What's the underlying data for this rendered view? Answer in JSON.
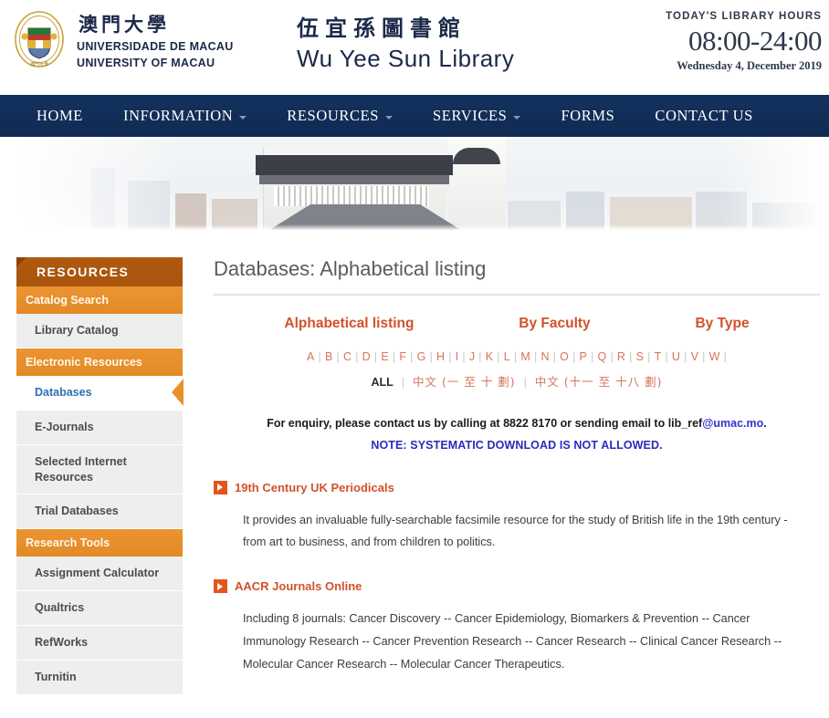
{
  "header": {
    "crest_icon": "university-crest-icon",
    "brand": {
      "cn": "澳門大學",
      "pt": "UNIVERSIDADE DE MACAU",
      "en": "UNIVERSITY OF MACAU"
    },
    "library": {
      "cn": "伍宜孫圖書館",
      "en": "Wu Yee Sun Library"
    },
    "hours": {
      "label": "TODAY'S LIBRARY HOURS",
      "time": "08:00-24:00",
      "date": "Wednesday 4, December 2019"
    }
  },
  "nav": {
    "items": [
      {
        "label": "HOME",
        "caret": false
      },
      {
        "label": "INFORMATION",
        "caret": true
      },
      {
        "label": "RESOURCES",
        "caret": true
      },
      {
        "label": "SERVICES",
        "caret": true
      },
      {
        "label": "FORMS",
        "caret": false
      },
      {
        "label": "CONTACT US",
        "caret": false
      }
    ]
  },
  "banner": {
    "alt": "wu-yee-sun-library-building-photo"
  },
  "sidebar": {
    "heading": "RESOURCES",
    "blocks": [
      {
        "type": "group",
        "label": "Catalog Search"
      },
      {
        "type": "link",
        "label": "Library Catalog",
        "active": false
      },
      {
        "type": "group",
        "label": "Electronic Resources"
      },
      {
        "type": "link",
        "label": "Databases",
        "active": true
      },
      {
        "type": "link",
        "label": "E-Journals",
        "active": false
      },
      {
        "type": "link",
        "label": "Selected Internet Resources",
        "active": false
      },
      {
        "type": "link",
        "label": "Trial Databases",
        "active": false
      },
      {
        "type": "group",
        "label": "Research Tools"
      },
      {
        "type": "link",
        "label": "Assignment Calculator",
        "active": false
      },
      {
        "type": "link",
        "label": "Qualtrics",
        "active": false
      },
      {
        "type": "link",
        "label": "RefWorks",
        "active": false
      },
      {
        "type": "link",
        "label": "Turnitin",
        "active": false
      }
    ]
  },
  "main": {
    "page_title": "Databases: Alphabetical listing",
    "tabs": [
      {
        "label": "Alphabetical listing",
        "active": true
      },
      {
        "label": "By Faculty",
        "active": false
      },
      {
        "label": "By Type",
        "active": false
      }
    ],
    "alphabet": [
      "A",
      "B",
      "C",
      "D",
      "E",
      "F",
      "G",
      "H",
      "I",
      "J",
      "K",
      "L",
      "M",
      "N",
      "O",
      "P",
      "Q",
      "R",
      "S",
      "T",
      "U",
      "V",
      "W"
    ],
    "alpha_separator": "|",
    "alpha_extra": {
      "all": "ALL",
      "cn_1": "中文 (一 至 十 劃)",
      "cn_2": "中文 (十一 至 十八 劃)"
    },
    "notice": {
      "line1_pre": "For enquiry, please contact us by calling at 8822 8170 or sending email to lib_ref",
      "line1_mail": "@umac.mo",
      "line1_post": ".",
      "line2": "NOTE: SYSTEMATIC DOWNLOAD IS NOT ALLOWED."
    },
    "databases": [
      {
        "title": "19th Century UK Periodicals",
        "description": "It provides an invaluable fully-searchable facsimile resource for the study of British life in the 19th century - from art to business, and from children to politics."
      },
      {
        "title": "AACR Journals Online",
        "description": "Including 8 journals: Cancer Discovery -- Cancer Epidemiology, Biomarkers & Prevention -- Cancer Immunology Research -- Cancer Prevention Research -- Cancer Research -- Clinical Cancer Research -- Molecular Cancer Research -- Molecular Cancer Therapeutics."
      }
    ]
  },
  "colors": {
    "nav_bg": "#13315f",
    "sidebar_head": "#b0590f",
    "sidebar_group": "#e8912b",
    "accent_orange": "#d1522b",
    "alpha_link": "#d6745c",
    "active_link_blue": "#2f6fb5",
    "notice_blue": "#2b2bbb"
  }
}
